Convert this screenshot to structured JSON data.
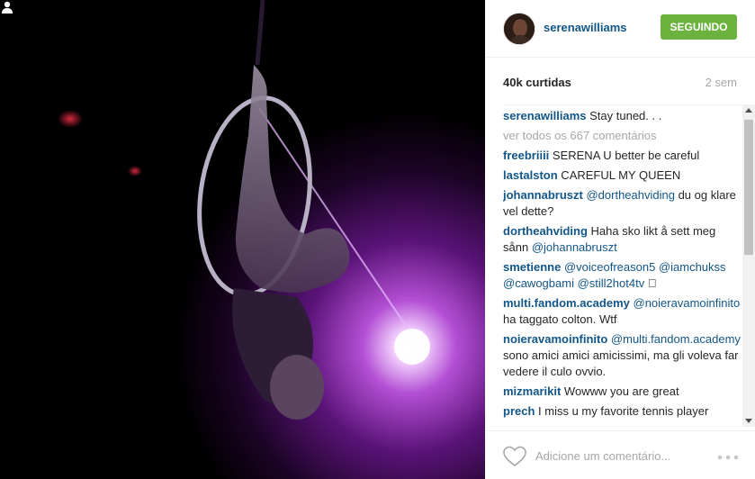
{
  "post": {
    "username": "serenawilliams",
    "follow_label": "SEGUINDO",
    "likes": "40k curtidas",
    "time": "2 sem",
    "caption": {
      "user": "serenawilliams",
      "text": "Stay tuned. . ."
    },
    "view_all": "ver todos os 667 comentários",
    "comments": [
      {
        "user": "freebriiii",
        "parts": [
          {
            "t": " SERENA U better be careful",
            "m": false
          }
        ]
      },
      {
        "user": "lastalston",
        "parts": [
          {
            "t": " CAREFUL MY QUEEN",
            "m": false
          }
        ]
      },
      {
        "user": "johannabruszt",
        "parts": [
          {
            "t": " ",
            "m": false
          },
          {
            "t": "@dortheahviding",
            "m": true
          },
          {
            "t": " du og klare vel dette?",
            "m": false
          }
        ]
      },
      {
        "user": "dortheahviding",
        "parts": [
          {
            "t": " Haha sko likt å sett meg sånn ",
            "m": false
          },
          {
            "t": "@johannabruszt",
            "m": true
          }
        ]
      },
      {
        "user": "smetienne",
        "parts": [
          {
            "t": " ",
            "m": false
          },
          {
            "t": "@voiceofreason5",
            "m": true
          },
          {
            "t": " ",
            "m": false
          },
          {
            "t": "@iamchukss",
            "m": true
          },
          {
            "t": " ",
            "m": false
          },
          {
            "t": "@cawogbami",
            "m": true
          },
          {
            "t": " ",
            "m": false
          },
          {
            "t": "@still2hot4tv",
            "m": true
          },
          {
            "t": " 🏾",
            "m": false
          }
        ]
      },
      {
        "user": "multi.fandom.academy",
        "parts": [
          {
            "t": " ",
            "m": false
          },
          {
            "t": "@noieravamoinfinito",
            "m": true
          },
          {
            "t": " ha taggato colton. Wtf",
            "m": false
          }
        ]
      },
      {
        "user": "noieravamoinfinito",
        "parts": [
          {
            "t": " ",
            "m": false
          },
          {
            "t": "@multi.fandom.academy",
            "m": true
          },
          {
            "t": " sono amici amici amicissimi, ma gli voleva far vedere il culo ovvio.",
            "m": false
          }
        ]
      },
      {
        "user": "mizmarikit",
        "parts": [
          {
            "t": " Wowww you are great",
            "m": false
          }
        ]
      },
      {
        "user": "prech",
        "parts": [
          {
            "t": " I miss u my favorite tennis player",
            "m": false
          }
        ]
      }
    ],
    "comment_placeholder": "Adicione um comentário..."
  },
  "icons": {
    "heart": "heart-icon",
    "more": "more-options-icon",
    "tag": "tagged-user-icon"
  },
  "colors": {
    "link": "#125688",
    "follow_button": "#6bb33e",
    "muted": "#a5a7aa"
  }
}
